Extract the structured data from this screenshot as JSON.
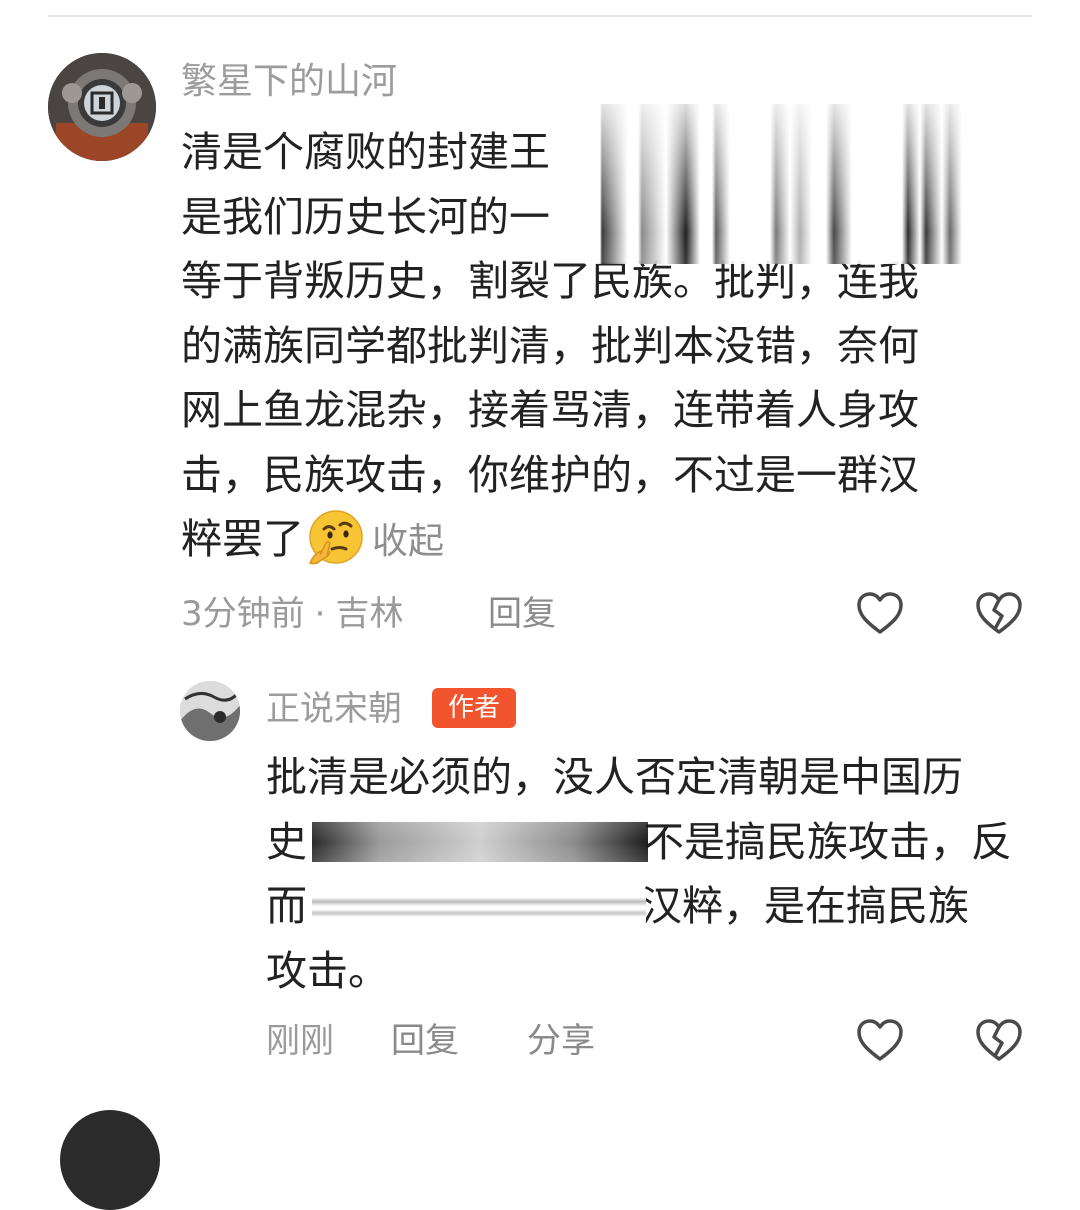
{
  "comment": {
    "username": "繁星下的山河",
    "lines": [
      "清是个腐败的封建王",
      "是我们历史长河的一",
      "等于背叛历史，割裂了民族。批判，连我",
      "的满族同学都批判清，批判本没错，奈何",
      "网上鱼龙混杂，接着骂清，连带着人身攻",
      "击，民族攻击，你维护的，不过是一群汉"
    ],
    "last_line_text": "粹罢了",
    "emoji": "thinking-face-emoji",
    "collapse_label": "收起",
    "time": "3分钟前",
    "separator": "·",
    "location": "吉林",
    "reply_label": "回复",
    "like_icon": "heart-outline-icon",
    "dislike_icon": "broken-heart-outline-icon"
  },
  "reply": {
    "username": "正说宋朝",
    "badge": "作者",
    "line1": "批清是必须的，没人否定清朝是中国历",
    "line2_start": "史",
    "line2_end": "不是搞民族攻击，反",
    "line3_start": "而",
    "line3_end": "汉粹，是在搞民族",
    "line4": "攻击。",
    "time": "刚刚",
    "reply_label": "回复",
    "share_label": "分享",
    "like_icon": "heart-outline-icon",
    "dislike_icon": "broken-heart-outline-icon"
  },
  "colors": {
    "text_primary": "#222222",
    "text_secondary": "#9a9a9a",
    "badge_bg": "#f2542d",
    "badge_text": "#ffffff"
  }
}
